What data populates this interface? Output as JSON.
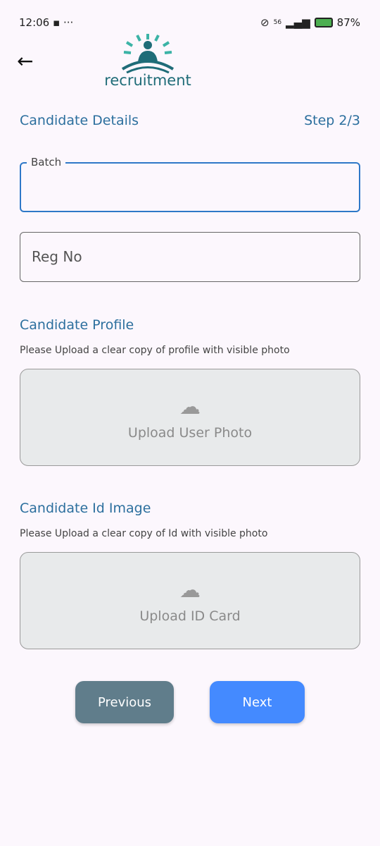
{
  "status": {
    "time": "12:06",
    "network": "56",
    "battery": "87%"
  },
  "header": {
    "logo_text": "recruitment"
  },
  "form": {
    "section_title": "Candidate Details",
    "step": "Step 2/3",
    "batch_label": "Batch",
    "batch_value": "",
    "regno_placeholder": "Reg No",
    "profile_title": "Candidate Profile",
    "profile_hint": "Please Upload a clear copy of profile with visible photo",
    "profile_upload": "Upload User Photo",
    "id_title": "Candidate Id Image",
    "id_hint": "Please Upload a clear copy of Id with visible photo",
    "id_upload": "Upload ID Card"
  },
  "buttons": {
    "previous": "Previous",
    "next": "Next"
  },
  "colors": {
    "accent": "#2c6f9e",
    "previous": "#607d8b",
    "next": "#448aff"
  }
}
